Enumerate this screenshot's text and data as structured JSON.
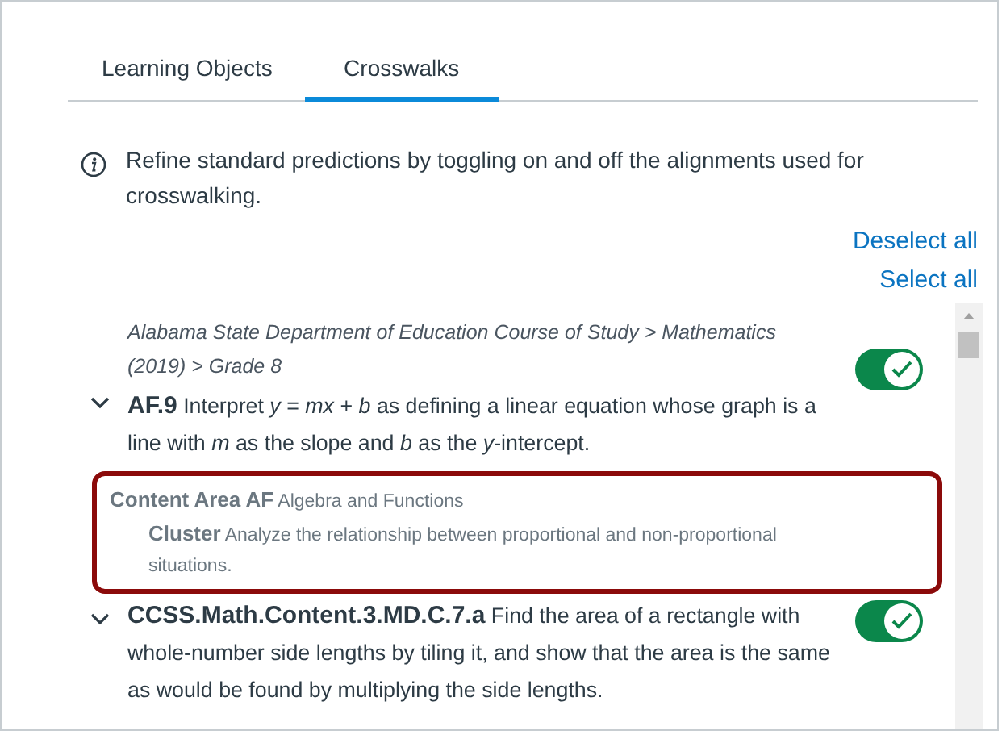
{
  "tabs": [
    {
      "label": "Learning Objects",
      "selected": false
    },
    {
      "label": "Crosswalks",
      "selected": true
    }
  ],
  "info": "Refine standard predictions by toggling on and off the alignments used for crosswalking.",
  "links": [
    "Deselect all",
    "Select all"
  ],
  "standards": [
    {
      "path": "Alabama State Department of Education Course of Study > Mathematics (2019) > Grade 8",
      "code": "AF.9",
      "text": "Interpret *y* = *mx* + *b* as defining a linear equation whose graph is a line with *m* as the slope and *b* as the *y*-intercept.",
      "expanded": true,
      "on": true,
      "details": [
        {
          "label": "Content Area AF",
          "text": "Algebra and Functions",
          "children": [
            {
              "label": "Cluster",
              "text": "Analyze the relationship between proportional and non-proportional situations."
            }
          ]
        }
      ]
    },
    {
      "code": "CCSS.Math.Content.3.MD.C.7.a",
      "text": "Find the area of a rectangle with whole-number side lengths by tiling it, and show that the area is the same as would be found by multiplying the side lengths.",
      "expanded": true,
      "on": true
    }
  ]
}
